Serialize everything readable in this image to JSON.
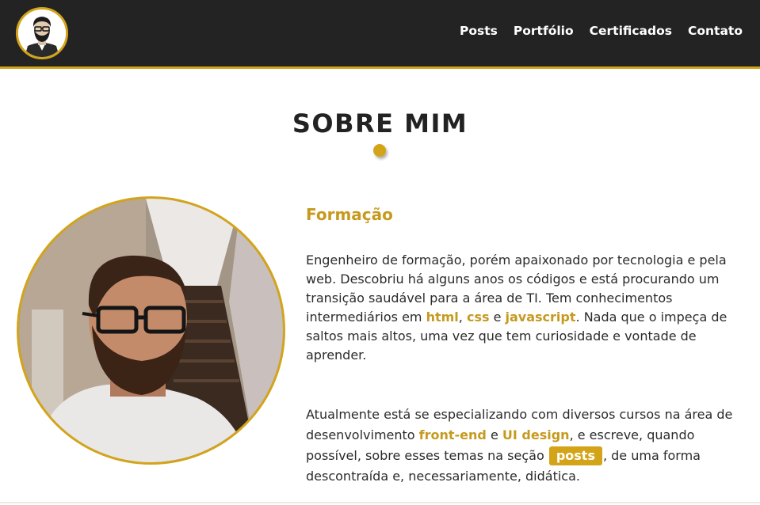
{
  "header": {
    "nav": [
      "Posts",
      "Portfólio",
      "Certificados",
      "Contato"
    ]
  },
  "page_title": "SOBRE MIM",
  "section": {
    "title": "Formação",
    "p1": {
      "t1": "Engenheiro de formação, porém apaixonado por tecnologia e pela web. Descobriu há alguns anos os códigos e está procurando um transição saudável para a área de TI. Tem conhecimentos intermediários em ",
      "kw1": "html",
      "t2": ", ",
      "kw2": "css",
      "t3": " e ",
      "kw3": "javascript",
      "t4": ". Nada que o impeça de saltos mais altos, uma vez que tem curiosidade e vontade de aprender."
    },
    "p2": {
      "t1": "Atualmente está se especializando com diversos cursos na área de desenvolvimento ",
      "kw1": "front-end",
      "t2": " e ",
      "kw2": "UI design",
      "t3": ", e escreve, quando possível, sobre esses temas na seção ",
      "button": "posts",
      "t4": ", de uma forma descontraída e, necessariamente, didática."
    }
  },
  "colors": {
    "accent": "#d4a418",
    "header_bg": "#232323"
  }
}
